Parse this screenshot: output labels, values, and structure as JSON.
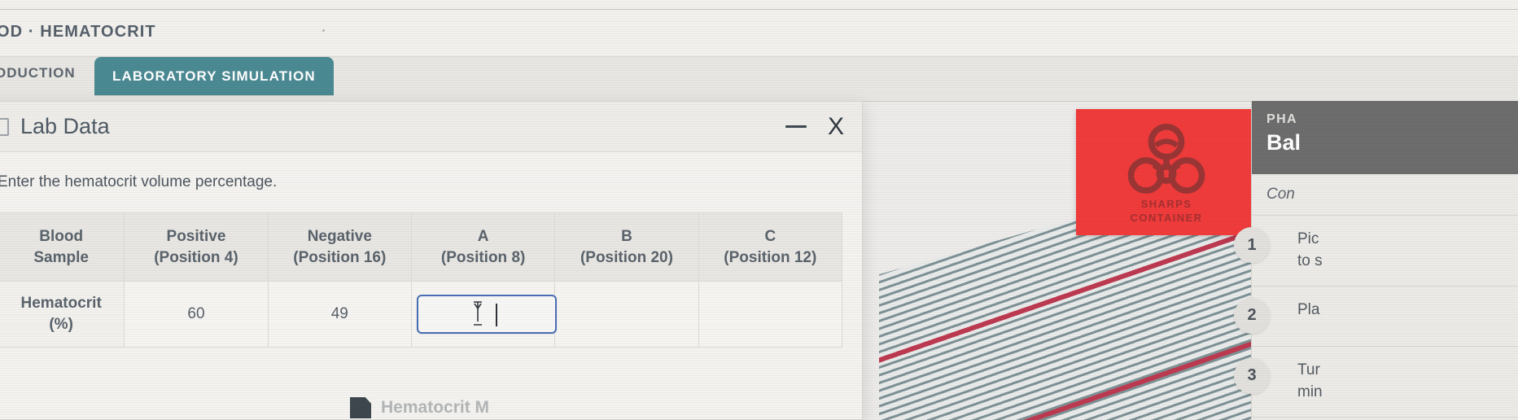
{
  "header": {
    "breadcrumb": "OD · HEMATOCRIT"
  },
  "tabs": {
    "inactive_label": "ODUCTION",
    "active_label": "LABORATORY SIMULATION",
    "active_color": "#4b8a93"
  },
  "dialog": {
    "title": "Lab Data",
    "icon": "clipboard-icon",
    "minimize_label": "—",
    "close_label": "X",
    "prompt": "Enter the hematocrit volume percentage.",
    "table": {
      "headers": [
        "Blood\nSample",
        "Positive\n(Position 4)",
        "Negative\n(Position 16)",
        "A\n(Position 8)",
        "B\n(Position 20)",
        "C\n(Position 12)"
      ],
      "header_lines": [
        [
          "Blood",
          "Sample"
        ],
        [
          "Positive",
          "(Position 4)"
        ],
        [
          "Negative",
          "(Position 16)"
        ],
        [
          "A",
          "(Position 8)"
        ],
        [
          "B",
          "(Position 20)"
        ],
        [
          "C",
          "(Position 12)"
        ]
      ],
      "rows": [
        {
          "label_lines": [
            "Hematocrit",
            "(%)"
          ],
          "cells": [
            "60",
            "49",
            "",
            "",
            ""
          ],
          "active_cell_index": 2,
          "active_cell_value": "",
          "active_cell_border_color": "#4a6fb5"
        }
      ]
    }
  },
  "sharps_container": {
    "line1": "SHARPS",
    "line2": "CONTAINER",
    "color": "#f03b3b",
    "symbol": "biohazard-icon"
  },
  "right_panel": {
    "phase_label": "PHA",
    "phase_name": "Bal",
    "subtitle": "Con",
    "steps": [
      {
        "num": "1",
        "lines": [
          "Pic",
          "to s"
        ]
      },
      {
        "num": "2",
        "lines": [
          "Pla"
        ]
      },
      {
        "num": "3",
        "lines": [
          "Tur",
          "min"
        ]
      }
    ]
  },
  "bottom_item": {
    "label": "Hematocrit M"
  }
}
